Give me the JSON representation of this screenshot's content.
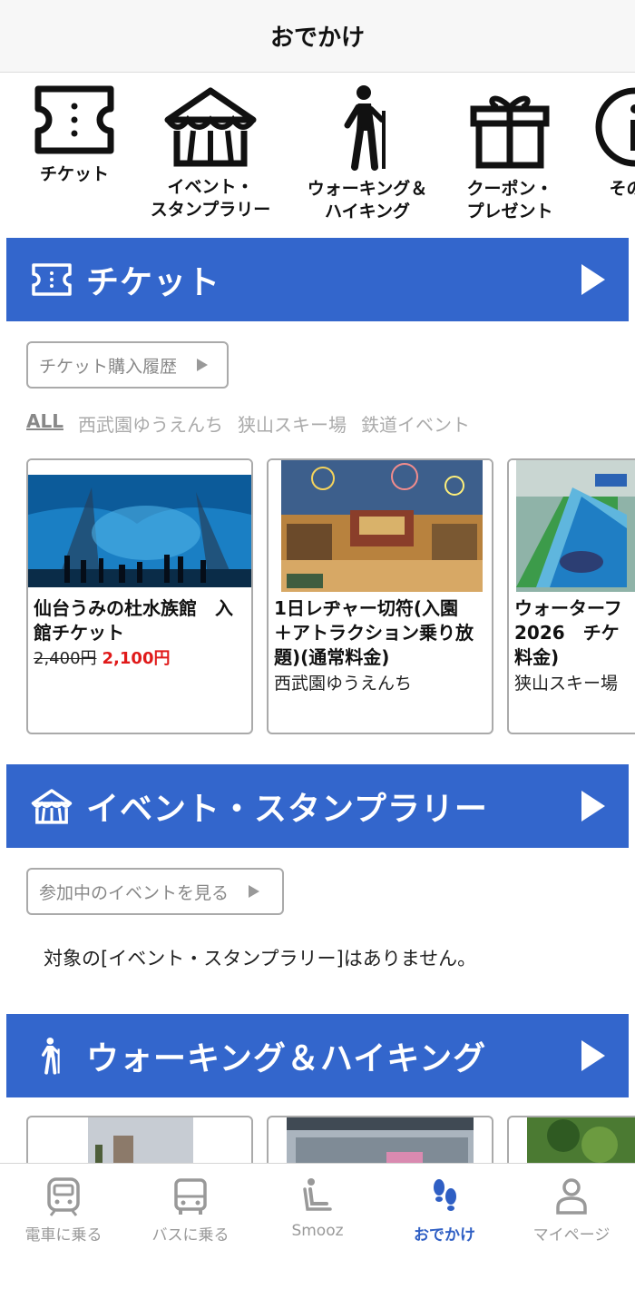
{
  "header": {
    "title": "おでかけ"
  },
  "categories": [
    {
      "icon": "ticket-icon",
      "label": "チケット"
    },
    {
      "icon": "circus-tent-icon",
      "label": "イベント・\nスタンプラリー"
    },
    {
      "icon": "hiker-icon",
      "label": "ウォーキング＆\nハイキング"
    },
    {
      "icon": "gift-icon",
      "label": "クーポン・\nプレゼント"
    },
    {
      "icon": "info-icon",
      "label": "その他"
    }
  ],
  "sections": {
    "ticket": {
      "icon": "ticket-icon",
      "title": "チケット"
    },
    "event": {
      "icon": "circus-tent-icon",
      "title": "イベント・スタンプラリー"
    },
    "walking": {
      "icon": "hiker-icon",
      "title": "ウォーキング＆ハイキング"
    }
  },
  "ticket_history_button": "チケット購入履歴",
  "filters": [
    "ALL",
    "西武園ゆうえんち",
    "狭山スキー場",
    "鉄道イベント"
  ],
  "ticket_cards": [
    {
      "title": "仙台うみの杜水族館　入\n館チケット",
      "old_price": "2,400円",
      "new_price": "2,100円",
      "place": ""
    },
    {
      "title": "1日レヂャー切符(入園\n＋アトラクション乗り放\n題)(通常料金)",
      "old_price": "",
      "new_price": "",
      "place": "西武園ゆうえんち"
    },
    {
      "title": "ウォーターフ\n2026　チケ\n料金)",
      "old_price": "",
      "new_price": "",
      "place": "狭山スキー場"
    }
  ],
  "event_button": "参加中のイベントを見る",
  "event_empty_message": "対象の[イベント・スタンプラリー]はありません。",
  "tabs": [
    {
      "icon": "train-icon",
      "label": "電車に乗る",
      "active": false
    },
    {
      "icon": "bus-icon",
      "label": "バスに乗る",
      "active": false
    },
    {
      "icon": "seat-icon",
      "label": "Smooz",
      "active": false
    },
    {
      "icon": "footprints-icon",
      "label": "おでかけ",
      "active": true
    },
    {
      "icon": "person-icon",
      "label": "マイページ",
      "active": false
    }
  ],
  "colors": {
    "banner": "#3366cc",
    "active_tab": "#2f5fc4",
    "sale_price": "#e01a1a"
  }
}
